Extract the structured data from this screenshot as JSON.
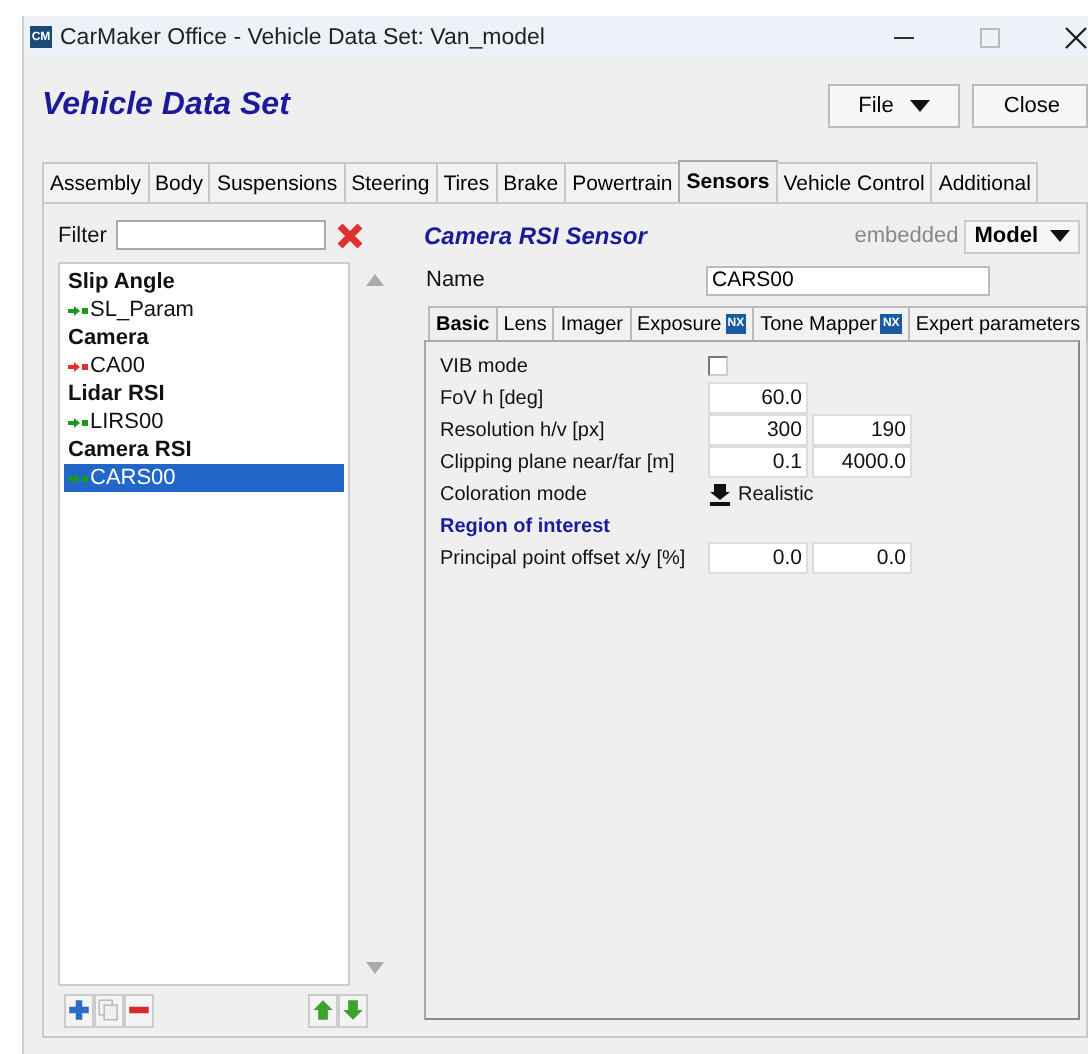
{
  "window": {
    "title": "CarMaker Office - Vehicle Data Set: Van_model",
    "app_badge": "CM"
  },
  "header": {
    "title": "Vehicle Data Set",
    "buttons": [
      {
        "label": "File",
        "dropdown": true
      },
      {
        "label": "Close",
        "dropdown": false
      }
    ]
  },
  "tabs": [
    {
      "label": "Assembly",
      "selected": false
    },
    {
      "label": "Body",
      "selected": false
    },
    {
      "label": "Suspensions",
      "selected": false
    },
    {
      "label": "Steering",
      "selected": false
    },
    {
      "label": "Tires",
      "selected": false
    },
    {
      "label": "Brake",
      "selected": false
    },
    {
      "label": "Powertrain",
      "selected": false
    },
    {
      "label": "Sensors",
      "selected": true
    },
    {
      "label": "Vehicle Control",
      "selected": false
    },
    {
      "label": "Additional",
      "selected": false
    }
  ],
  "sidebar": {
    "filter_label": "Filter",
    "items": [
      {
        "kind": "group",
        "label": "Slip Angle",
        "selected": false
      },
      {
        "kind": "item",
        "label": "SL_Param",
        "color": "#1a9a1a",
        "selected": false
      },
      {
        "kind": "group",
        "label": "Camera",
        "selected": false
      },
      {
        "kind": "item",
        "label": "CA00",
        "color": "#e23030",
        "selected": false
      },
      {
        "kind": "group",
        "label": "Lidar RSI",
        "selected": false
      },
      {
        "kind": "item",
        "label": "LIRS00",
        "color": "#1a9a1a",
        "selected": false
      },
      {
        "kind": "group",
        "label": "Camera RSI",
        "selected": false
      },
      {
        "kind": "item",
        "label": "CARS00",
        "color": "#1a9a1a",
        "selected": true
      }
    ],
    "tools": [
      {
        "kind": "add",
        "disabled": false
      },
      {
        "kind": "copy",
        "disabled": true
      },
      {
        "kind": "remove",
        "disabled": false
      },
      {
        "kind": "up",
        "disabled": false
      },
      {
        "kind": "down",
        "disabled": false
      }
    ]
  },
  "sensor": {
    "title": "Camera RSI Sensor",
    "mode_label": "embedded",
    "mode_button": "Model",
    "name_label": "Name",
    "name_value": "CARS00",
    "subtabs": [
      {
        "label": "Basic",
        "selected": true
      },
      {
        "label": "Lens",
        "selected": false
      },
      {
        "label": "Imager",
        "selected": false
      },
      {
        "label": "Exposure",
        "selected": false,
        "badge": "NX"
      },
      {
        "label": "Tone Mapper",
        "selected": false,
        "badge": "NX"
      },
      {
        "label": "Expert parameters",
        "selected": false
      }
    ],
    "fields": [
      {
        "kind": "checkbox",
        "label": "VIB mode",
        "checked": false
      },
      {
        "kind": "values",
        "label": "FoV h [deg]",
        "values": [
          "60.0"
        ]
      },
      {
        "kind": "values",
        "label": "Resolution h/v [px]",
        "values": [
          "300",
          "190"
        ]
      },
      {
        "kind": "values",
        "label": "Clipping plane near/far [m]",
        "values": [
          "0.1",
          "4000.0"
        ]
      },
      {
        "kind": "select",
        "label": "Coloration mode",
        "value": "Realistic"
      },
      {
        "kind": "heading",
        "label": "Region of interest"
      },
      {
        "kind": "values",
        "label": "Principal point offset x/y [%]",
        "values": [
          "0.0",
          "0.0"
        ]
      }
    ]
  }
}
